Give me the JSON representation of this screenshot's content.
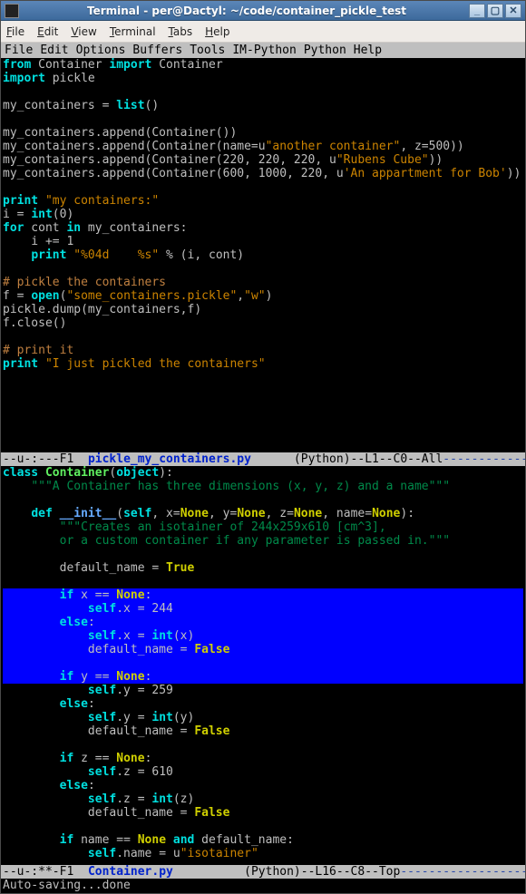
{
  "window": {
    "title": "Terminal - per@Dactyl: ~/code/container_pickle_test"
  },
  "gnome_menu": [
    "File",
    "Edit",
    "View",
    "Terminal",
    "Tabs",
    "Help"
  ],
  "emacs_menu": [
    "File",
    "Edit",
    "Options",
    "Buffers",
    "Tools",
    "IM-Python",
    "Python",
    "Help"
  ],
  "buffer1": {
    "lines": [
      {
        "t": "code",
        "seg": [
          [
            "kw",
            "from"
          ],
          [
            "plain",
            " Container "
          ],
          [
            "kw",
            "import"
          ],
          [
            "plain",
            " Container"
          ]
        ]
      },
      {
        "t": "code",
        "seg": [
          [
            "kw",
            "import"
          ],
          [
            "plain",
            " pickle"
          ]
        ]
      },
      {
        "t": "blank"
      },
      {
        "t": "code",
        "seg": [
          [
            "plain",
            "my_containers = "
          ],
          [
            "builtin",
            "list"
          ],
          [
            "plain",
            "()"
          ]
        ]
      },
      {
        "t": "blank"
      },
      {
        "t": "code",
        "seg": [
          [
            "plain",
            "my_containers.append(Container())"
          ]
        ]
      },
      {
        "t": "code",
        "seg": [
          [
            "plain",
            "my_containers.append(Container(name=u"
          ],
          [
            "strlit",
            "\"another container\""
          ],
          [
            "plain",
            ", z=500))"
          ]
        ]
      },
      {
        "t": "code",
        "seg": [
          [
            "plain",
            "my_containers.append(Container(220, 220, 220, u"
          ],
          [
            "strlit",
            "\"Rubens Cube\""
          ],
          [
            "plain",
            "))"
          ]
        ]
      },
      {
        "t": "code",
        "seg": [
          [
            "plain",
            "my_containers.append(Container(600, 1000, 220, u"
          ],
          [
            "strlit",
            "'An appartment for Bob'"
          ],
          [
            "plain",
            "))"
          ]
        ]
      },
      {
        "t": "blank"
      },
      {
        "t": "code",
        "seg": [
          [
            "kw",
            "print"
          ],
          [
            "plain",
            " "
          ],
          [
            "strlit",
            "\"my containers:\""
          ]
        ]
      },
      {
        "t": "code",
        "seg": [
          [
            "plain",
            "i = "
          ],
          [
            "builtin",
            "int"
          ],
          [
            "plain",
            "(0)"
          ]
        ]
      },
      {
        "t": "code",
        "seg": [
          [
            "kw",
            "for"
          ],
          [
            "plain",
            " cont "
          ],
          [
            "kw",
            "in"
          ],
          [
            "plain",
            " my_containers:"
          ]
        ]
      },
      {
        "t": "code",
        "seg": [
          [
            "plain",
            "    i += 1"
          ]
        ]
      },
      {
        "t": "code",
        "seg": [
          [
            "plain",
            "    "
          ],
          [
            "kw",
            "print"
          ],
          [
            "plain",
            " "
          ],
          [
            "strlit",
            "\"%04d    %s\""
          ],
          [
            "plain",
            " % (i, cont)"
          ]
        ]
      },
      {
        "t": "blank"
      },
      {
        "t": "code",
        "seg": [
          [
            "comment",
            "# pickle the containers"
          ]
        ]
      },
      {
        "t": "code",
        "seg": [
          [
            "plain",
            "f = "
          ],
          [
            "builtin",
            "open"
          ],
          [
            "plain",
            "("
          ],
          [
            "strlit",
            "\"some_containers.pickle\""
          ],
          [
            "plain",
            ","
          ],
          [
            "strlit",
            "\"w\""
          ],
          [
            "plain",
            ")"
          ]
        ]
      },
      {
        "t": "code",
        "seg": [
          [
            "plain",
            "pickle.dump(my_containers,f)"
          ]
        ]
      },
      {
        "t": "code",
        "seg": [
          [
            "plain",
            "f.close()"
          ]
        ]
      },
      {
        "t": "blank"
      },
      {
        "t": "code",
        "seg": [
          [
            "comment",
            "# print it"
          ]
        ]
      },
      {
        "t": "code",
        "seg": [
          [
            "kw",
            "print"
          ],
          [
            "plain",
            " "
          ],
          [
            "strlit",
            "\"I just pickled the containers\""
          ]
        ]
      }
    ]
  },
  "modeline1": {
    "prefix": "--u-:---",
    "frame": "F1",
    "file": "pickle_my_containers.py",
    "mode": "(Python)--L1--C0--All",
    "dashes": "--------------------"
  },
  "buffer2": {
    "lines": [
      {
        "t": "code",
        "seg": [
          [
            "kw",
            "class"
          ],
          [
            "plain",
            " "
          ],
          [
            "type",
            "Container"
          ],
          [
            "plain",
            "("
          ],
          [
            "builtin",
            "object"
          ],
          [
            "plain",
            "):"
          ]
        ]
      },
      {
        "t": "code",
        "seg": [
          [
            "plain",
            "    "
          ],
          [
            "docstr",
            "\"\"\"A Container has three dimensions (x, y, z) and a name\"\"\""
          ]
        ]
      },
      {
        "t": "blank"
      },
      {
        "t": "code",
        "seg": [
          [
            "plain",
            "    "
          ],
          [
            "kw",
            "def"
          ],
          [
            "plain",
            " "
          ],
          [
            "func",
            "__init__"
          ],
          [
            "plain",
            "("
          ],
          [
            "kw",
            "self"
          ],
          [
            "plain",
            ", x="
          ],
          [
            "const",
            "None"
          ],
          [
            "plain",
            ", y="
          ],
          [
            "const",
            "None"
          ],
          [
            "plain",
            ", z="
          ],
          [
            "const",
            "None"
          ],
          [
            "plain",
            ", name="
          ],
          [
            "const",
            "None"
          ],
          [
            "plain",
            "):"
          ]
        ]
      },
      {
        "t": "code",
        "seg": [
          [
            "plain",
            "        "
          ],
          [
            "docstr",
            "\"\"\"Creates an isotainer of 244x259x610 [cm^3],"
          ]
        ]
      },
      {
        "t": "code",
        "seg": [
          [
            "plain",
            "        "
          ],
          [
            "docstr",
            "or a custom container if any parameter is passed in.\"\"\""
          ]
        ]
      },
      {
        "t": "blank"
      },
      {
        "t": "code",
        "seg": [
          [
            "plain",
            "        default_name = "
          ],
          [
            "const",
            "True"
          ]
        ]
      },
      {
        "t": "blank"
      },
      {
        "t": "code",
        "sel": true,
        "seg": [
          [
            "plain",
            "        "
          ],
          [
            "kw",
            "if"
          ],
          [
            "plain",
            " x == "
          ],
          [
            "const",
            "None"
          ],
          [
            "plain",
            ":"
          ]
        ]
      },
      {
        "t": "code",
        "sel": true,
        "seg": [
          [
            "plain",
            "            "
          ],
          [
            "kw",
            "self"
          ],
          [
            "plain",
            ".x = 244"
          ]
        ]
      },
      {
        "t": "code",
        "sel": true,
        "seg": [
          [
            "plain",
            "        "
          ],
          [
            "kw",
            "else"
          ],
          [
            "plain",
            ":"
          ]
        ]
      },
      {
        "t": "code",
        "sel": true,
        "seg": [
          [
            "plain",
            "            "
          ],
          [
            "kw",
            "self"
          ],
          [
            "plain",
            ".x = "
          ],
          [
            "builtin",
            "int"
          ],
          [
            "plain",
            "(x)"
          ]
        ]
      },
      {
        "t": "code",
        "sel": true,
        "seg": [
          [
            "plain",
            "            default_name = "
          ],
          [
            "const",
            "False"
          ]
        ]
      },
      {
        "t": "blank",
        "sel": true
      },
      {
        "t": "code",
        "sel": true,
        "seg": [
          [
            "plain",
            "        "
          ],
          [
            "kw",
            "if"
          ],
          [
            "plain",
            " y == "
          ],
          [
            "const",
            "None"
          ],
          [
            "plain",
            ":"
          ]
        ]
      },
      {
        "t": "code",
        "seg": [
          [
            "plain",
            "            "
          ],
          [
            "kw",
            "self"
          ],
          [
            "plain",
            ".y = 259"
          ]
        ]
      },
      {
        "t": "code",
        "seg": [
          [
            "plain",
            "        "
          ],
          [
            "kw",
            "else"
          ],
          [
            "plain",
            ":"
          ]
        ]
      },
      {
        "t": "code",
        "seg": [
          [
            "plain",
            "            "
          ],
          [
            "kw",
            "self"
          ],
          [
            "plain",
            ".y = "
          ],
          [
            "builtin",
            "int"
          ],
          [
            "plain",
            "(y)"
          ]
        ]
      },
      {
        "t": "code",
        "seg": [
          [
            "plain",
            "            default_name = "
          ],
          [
            "const",
            "False"
          ]
        ]
      },
      {
        "t": "blank"
      },
      {
        "t": "code",
        "seg": [
          [
            "plain",
            "        "
          ],
          [
            "kw",
            "if"
          ],
          [
            "plain",
            " z == "
          ],
          [
            "const",
            "None"
          ],
          [
            "plain",
            ":"
          ]
        ]
      },
      {
        "t": "code",
        "seg": [
          [
            "plain",
            "            "
          ],
          [
            "kw",
            "self"
          ],
          [
            "plain",
            ".z = 610"
          ]
        ]
      },
      {
        "t": "code",
        "seg": [
          [
            "plain",
            "        "
          ],
          [
            "kw",
            "else"
          ],
          [
            "plain",
            ":"
          ]
        ]
      },
      {
        "t": "code",
        "seg": [
          [
            "plain",
            "            "
          ],
          [
            "kw",
            "self"
          ],
          [
            "plain",
            ".z = "
          ],
          [
            "builtin",
            "int"
          ],
          [
            "plain",
            "(z)"
          ]
        ]
      },
      {
        "t": "code",
        "seg": [
          [
            "plain",
            "            default_name = "
          ],
          [
            "const",
            "False"
          ]
        ]
      },
      {
        "t": "blank"
      },
      {
        "t": "code",
        "seg": [
          [
            "plain",
            "        "
          ],
          [
            "kw",
            "if"
          ],
          [
            "plain",
            " name == "
          ],
          [
            "const",
            "None"
          ],
          [
            "plain",
            " "
          ],
          [
            "kw",
            "and"
          ],
          [
            "plain",
            " default_name:"
          ]
        ]
      },
      {
        "t": "code",
        "seg": [
          [
            "plain",
            "            "
          ],
          [
            "kw",
            "self"
          ],
          [
            "plain",
            ".name = u"
          ],
          [
            "strlit",
            "\"isotainer\""
          ]
        ]
      }
    ]
  },
  "modeline2": {
    "prefix": "--u-:**-",
    "frame": "F1",
    "file": "Container.py",
    "mode": "(Python)--L16--C8--Top",
    "dashes": "-------------------------"
  },
  "minibuffer": "Auto-saving...done"
}
